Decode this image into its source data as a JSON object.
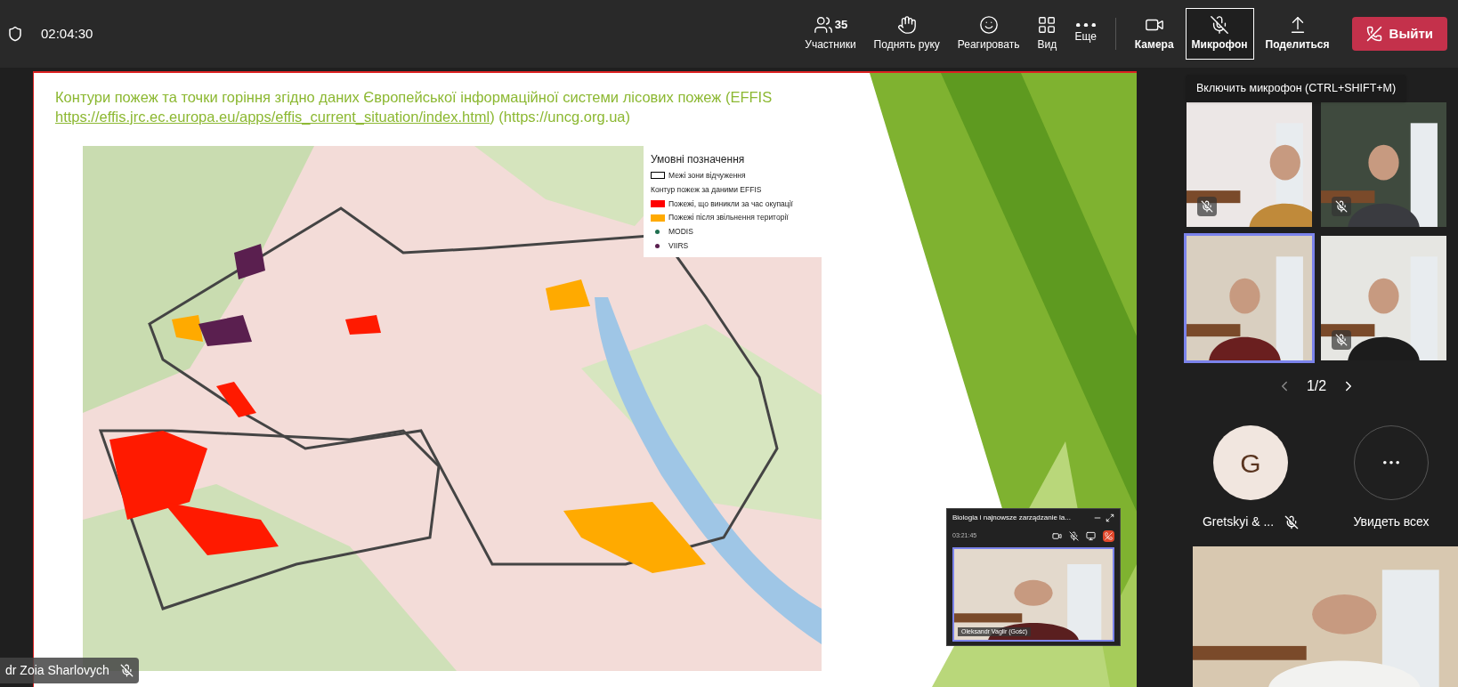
{
  "top_bar": {
    "timer": "02:04:30",
    "controls": [
      {
        "kind": "people",
        "label": "Участники",
        "count": "35",
        "selected": false
      },
      {
        "kind": "hand",
        "label": "Поднять руку",
        "selected": false
      },
      {
        "kind": "react",
        "label": "Реагировать",
        "selected": false
      },
      {
        "kind": "view",
        "label": "Вид",
        "selected": false
      },
      {
        "kind": "more",
        "label": "Еще",
        "selected": false
      }
    ],
    "media": [
      {
        "kind": "camera",
        "label": "Камера",
        "selected": false
      },
      {
        "kind": "mic",
        "label": "Микрофон",
        "selected": true
      },
      {
        "kind": "share",
        "label": "Поделиться",
        "selected": false
      }
    ],
    "leave_button": "Выйти"
  },
  "slide": {
    "title": {
      "text_before": "Контури пожеж та точки горіння згідно даних Європейської інформаційної системи лісових пожеж (EFFIS ",
      "link": "https://effis.jrc.ec.europa.eu/apps/effis_current_situation/index.html",
      "text_after": ") (https://uncg.org.ua)"
    },
    "legend": {
      "title": "Умовні позначення",
      "items": [
        {
          "kind": "outline",
          "label": "Межі зони відчуження"
        },
        {
          "kind": "heading",
          "label": "Контур пожеж за даними EFFIS"
        },
        {
          "kind": "swatch",
          "label": "Пожежі, що виникли за час окупації",
          "color": "#ff0000"
        },
        {
          "kind": "swatch",
          "label": "Пожежі після звільнення території",
          "color": "#ffaa00"
        },
        {
          "kind": "dot",
          "label": "MODIS",
          "color": "#1f6f4f"
        },
        {
          "kind": "dot",
          "label": "VIIRS",
          "color": "#5a1f4f"
        }
      ]
    }
  },
  "mini_window": {
    "title": "Biologia i najnowsze zarządzanie la...",
    "timer": "03:21:45",
    "participant": "Oleksandr Vaglir (Gość)"
  },
  "presenter_tag": {
    "name": "dr Zoia Sharlovych",
    "muted": true
  },
  "tooltip": "Включить микрофон (CTRL+SHIFT+M)",
  "video_tiles": [
    {
      "muted": true,
      "selected": false
    },
    {
      "muted": true,
      "selected": false
    },
    {
      "muted": false,
      "selected": true
    },
    {
      "muted": true,
      "selected": false
    }
  ],
  "pagination": "1/2",
  "participants": [
    {
      "initial": "G",
      "name": "Gretskyi & ...",
      "muted": true
    }
  ],
  "see_all": "Увидеть всех"
}
